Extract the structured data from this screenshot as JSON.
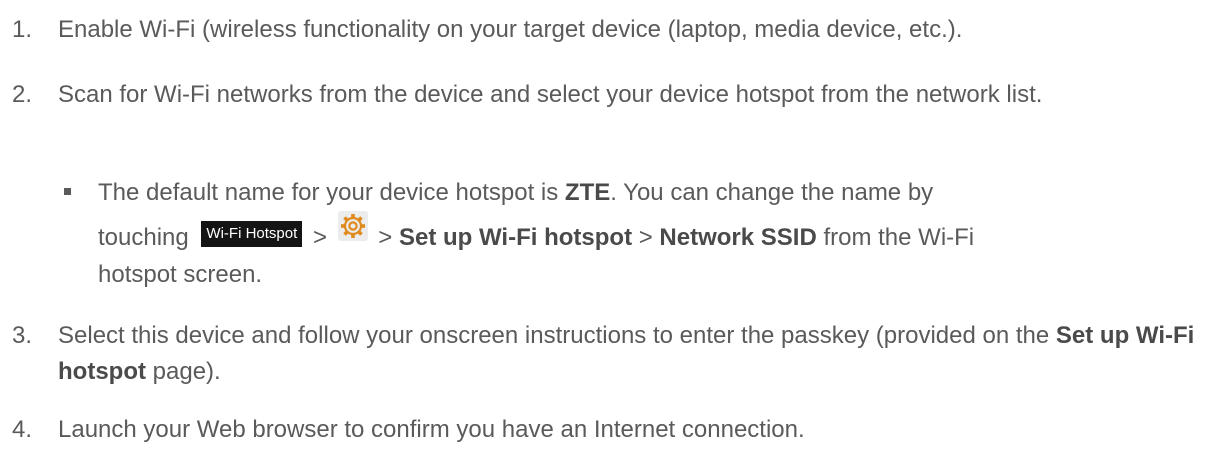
{
  "steps": [
    {
      "number": "1.",
      "text": "Enable Wi-Fi (wireless functionality on your target device (laptop, media device, etc.)."
    },
    {
      "number": "2.",
      "text": "Scan for Wi-Fi networks from the device and select your device hotspot from the network list."
    },
    {
      "number": "3.",
      "text_before": "Select this device and follow your onscreen instructions to enter the passkey (provided on the ",
      "bold": "Set up Wi-Fi hotspot",
      "text_after": " page)."
    },
    {
      "number": "4.",
      "text": "Launch your Web browser to confirm you have an Internet connection."
    }
  ],
  "note": {
    "line1_before": "The default name for your device hotspot is ",
    "line1_bold": "ZTE",
    "line1_after": ". You can change the name by",
    "touching": "touching",
    "hotspot_button_label": "Wi-Fi Hotspot",
    "sep": ">",
    "gear_icon": "gear-icon",
    "setup_label": "Set up Wi-Fi hotspot",
    "ssid_label": "Network SSID",
    "tail": " from the Wi-Fi",
    "line3": "hotspot screen."
  },
  "colors": {
    "text": "#5a5a5a",
    "button_bg": "#141414",
    "gear_orange": "#e08a1e"
  }
}
